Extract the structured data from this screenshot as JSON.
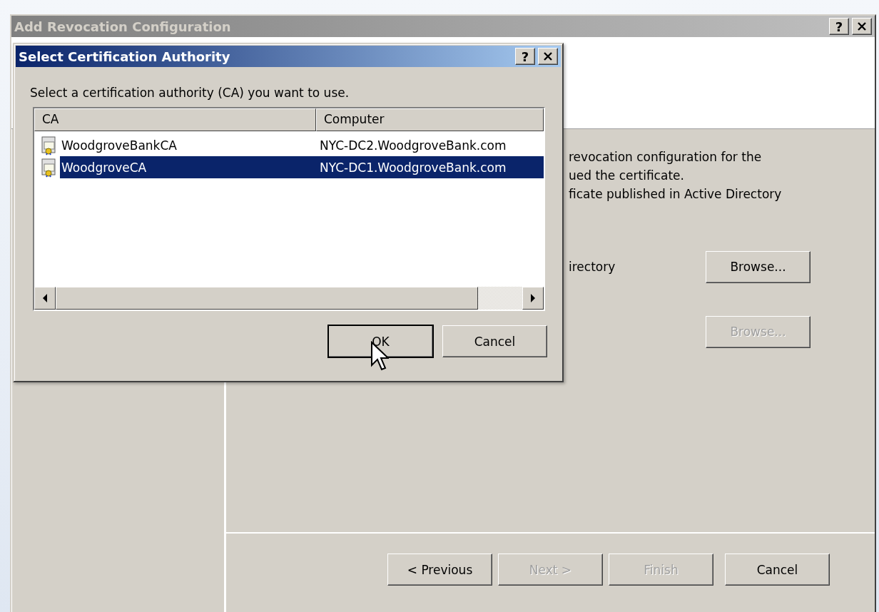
{
  "window": {
    "title": "Add Revocation Configuration",
    "active": false,
    "help": "?"
  },
  "intro_lines": [
    "revocation configuration for the",
    "ued the certificate.",
    "ficate published in Active Directory"
  ],
  "browse_rows": [
    {
      "label": "irectory",
      "button": {
        "label": "Browse...",
        "disabled": false
      }
    },
    {
      "button": {
        "label": "Browse...",
        "disabled": true
      }
    }
  ],
  "nav_buttons": [
    {
      "label": "< Previous",
      "disabled": false
    },
    {
      "label": "Next >",
      "disabled": true
    },
    {
      "label": "Finish",
      "disabled": true
    },
    {
      "label": "Cancel",
      "disabled": false
    }
  ],
  "dialog": {
    "title": "Select Certification Authority",
    "active": true,
    "help": "?",
    "prompt": "Select a certification authority (CA) you want to use.",
    "columns": [
      "CA",
      "Computer"
    ],
    "rows": [
      {
        "ca": "WoodgroveBankCA",
        "computer": "NYC-DC2.WoodgroveBank.com",
        "selected": false
      },
      {
        "ca": "WoodgroveCA",
        "computer": "NYC-DC1.WoodgroveBank.com",
        "selected": true
      }
    ],
    "buttons": [
      {
        "label": "OK",
        "default": true
      },
      {
        "label": "Cancel",
        "default": false
      }
    ]
  }
}
